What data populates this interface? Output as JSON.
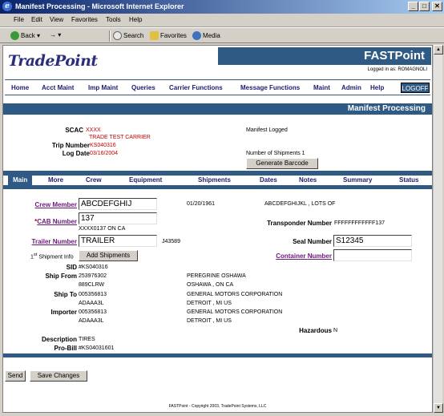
{
  "window": {
    "title": "Manifest Processing - Microsoft Internet Explorer",
    "min": "_",
    "max": "□",
    "close": "✕"
  },
  "menu": [
    "File",
    "Edit",
    "View",
    "Favorites",
    "Tools",
    "Help"
  ],
  "toolbar": {
    "back": "Back",
    "forward": "→",
    "search": "Search",
    "favorites": "Favorites",
    "media": "Media"
  },
  "header": {
    "logo": "TradePoint",
    "app_name": "FASTPoint",
    "logged_in": "Logged in as: ROMAGNOLI"
  },
  "nav": [
    "Home",
    "Acct Maint",
    "Imp Maint",
    "Queries",
    "Carrier Functions",
    "Message Functions",
    "Maint",
    "Admin",
    "Help"
  ],
  "logoff": "LOGOFF",
  "section_title": "Manifest Processing",
  "summary": {
    "scac_label": "SCAC",
    "scac_value": "XXXX",
    "carrier_name": "TRADE TEST CARRIER",
    "trip_label": "Trip Number",
    "trip_value": "KS040316",
    "logdate_label": "Log Date",
    "logdate_value": "03/16/2004",
    "status": "Manifest Logged",
    "shipments": "Number of Shipments 1",
    "barcode_button": "Generate Barcode"
  },
  "tabs": [
    "Main",
    "More",
    "Crew",
    "Equipment",
    "Shipments",
    "Dates",
    "Notes",
    "Summary",
    "Status"
  ],
  "main": {
    "crew_member_label": "Crew Member",
    "crew_member_value": "ABCDEFGHIJ",
    "crew_dob": "01/20/1961",
    "crew_name": "ABCDEFGHIJKL , LOTS OF",
    "cab_label": "CAB Number",
    "cab_star": "*",
    "cab_value": "137",
    "cab_desc": "XXXX0137 ON CA",
    "transponder_label": "Transponder Number",
    "transponder_value": "FFFFFFFFFFFF137",
    "trailer_label": "Trailer Number",
    "trailer_value": "TRAILER",
    "trailer_code": "J43589",
    "seal_label": "Seal Number",
    "seal_value": "S12345",
    "shipment_info_prefix": "1",
    "shipment_info_sup": "st",
    "shipment_info_text": "Shipment Info",
    "add_shipments": "Add Shipments",
    "container_label": "Container Number",
    "container_value": "",
    "sid_label": "SID",
    "sid_value": "#KS040316",
    "shipfrom_label": "Ship From",
    "shipfrom_id": "253976302",
    "shipfrom_name": "PEREGRINE OSHAWA",
    "shipfrom_code": "889CLRW",
    "shipfrom_city": "OSHAWA , ON CA",
    "shipto_label": "Ship To",
    "shipto_id": "005356813",
    "shipto_name": "GENERAL MOTORS CORPORATION",
    "shipto_code": "ADAAA3L",
    "shipto_city": "DETROIT , MI US",
    "importer_label": "Importer",
    "importer_id": "005356813",
    "importer_name": "GENERAL MOTORS CORPORATION",
    "importer_code": "ADAAA3L",
    "importer_city": "DETROIT , MI US",
    "hazardous_label": "Hazardous",
    "hazardous_value": "N",
    "description_label": "Description",
    "description_value": "TIRES",
    "probill_label": "Pro-Bill",
    "probill_value": "#KS04031601"
  },
  "actions": {
    "send": "Send",
    "save": "Save Changes"
  },
  "footer": "FASTPoint - Copyright 2003, TradePoint Systems, LLC"
}
